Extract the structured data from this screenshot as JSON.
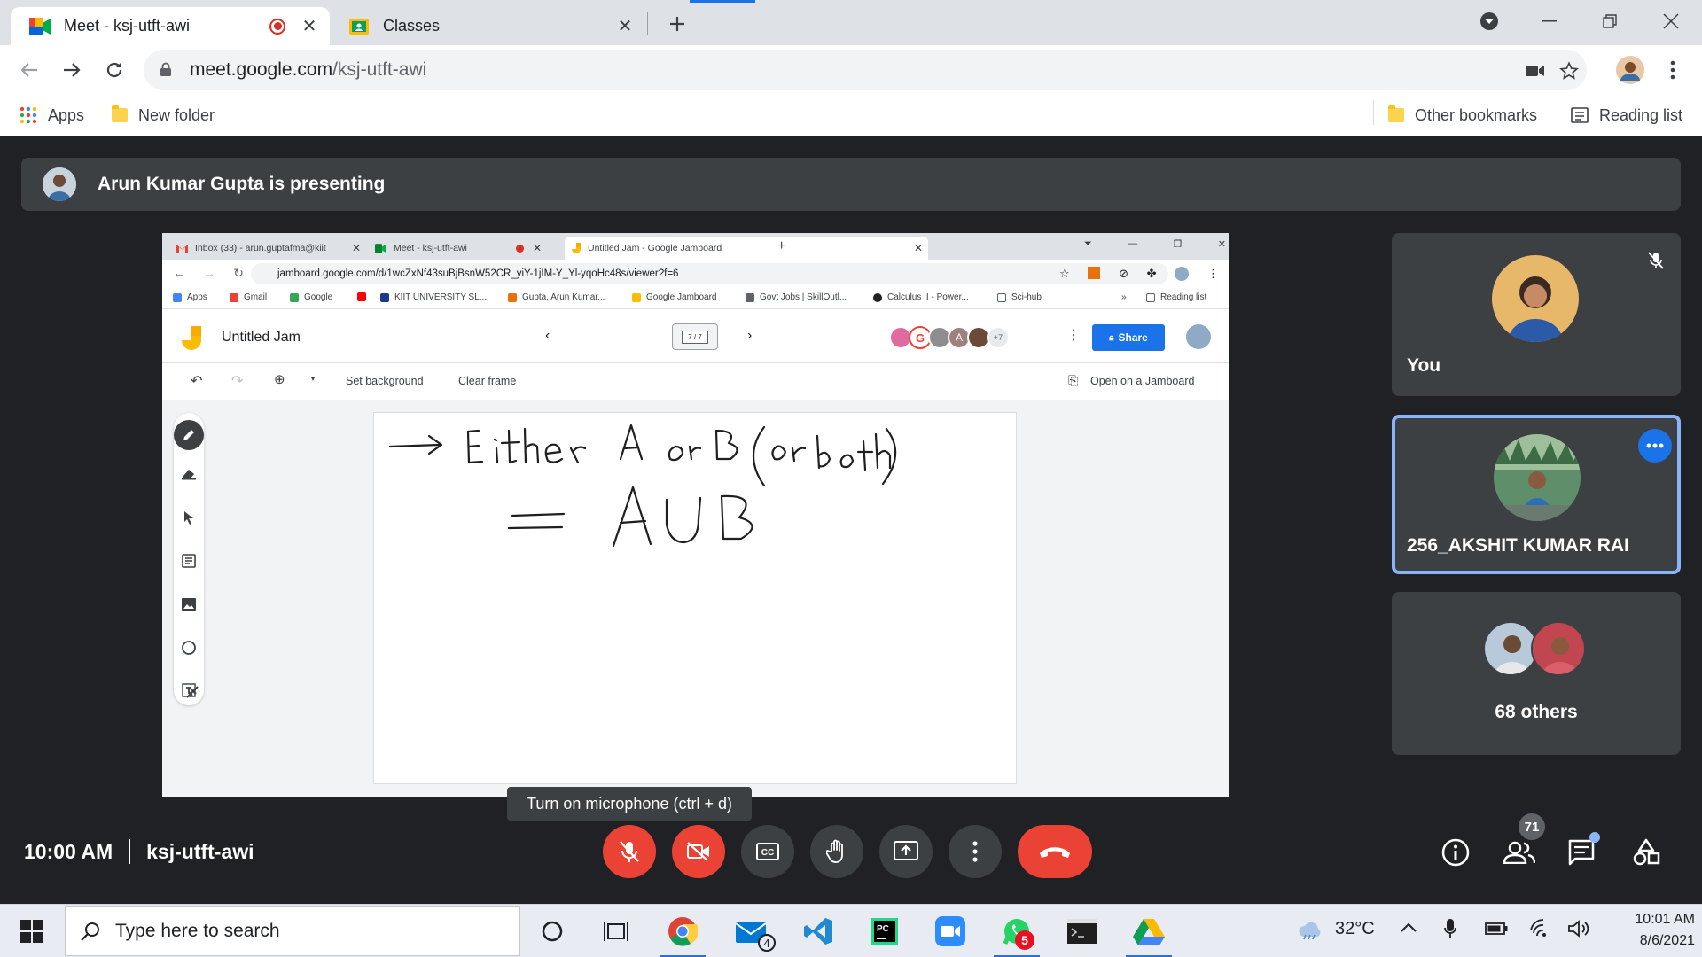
{
  "browser": {
    "tabs": [
      {
        "title": "Meet - ksj-utft-awi",
        "active": true,
        "recording": true
      },
      {
        "title": "Classes",
        "active": false
      }
    ],
    "url_host": "meet.google.com",
    "url_path": "/ksj-utft-awi",
    "bookmarks": {
      "apps": "Apps",
      "new_folder": "New folder",
      "other": "Other bookmarks",
      "reading_list": "Reading list"
    }
  },
  "meet": {
    "presenter_text": "Arun Kumar Gupta is presenting",
    "time": "10:00 AM",
    "meeting_code": "ksj-utft-awi",
    "tooltip": "Turn on microphone (ctrl + d)",
    "participants_count": "71",
    "tiles": [
      {
        "name": "You",
        "muted": true
      },
      {
        "name": "256_AKSHIT KUMAR RAI",
        "active_speaker": true
      },
      {
        "name": "68 others"
      }
    ],
    "accent_color": "#8ab4f8",
    "danger_color": "#ea4335"
  },
  "shared_screen": {
    "tabs": [
      "Inbox (33) - arun.guptafma@kiit",
      "Meet - ksj-utft-awi",
      "Untitled Jam - Google Jamboard"
    ],
    "url": "jamboard.google.com/d/1wcZxNf43suBjBsnW52CR_yiY-1jIM-Y_Yl-yqoHc48s/viewer?f=6",
    "bookmarks": [
      "Apps",
      "Gmail",
      "Google",
      "KIIT UNIVERSITY SL...",
      "Gupta, Arun Kumar...",
      "Google Jamboard",
      "Govt Jobs | SkillOutl...",
      "Calculus II - Power...",
      "Sci-hub"
    ],
    "bookmarks_more": "»",
    "reading_list": "Reading list",
    "jamboard": {
      "title": "Untitled Jam",
      "frame": "7 / 7",
      "collaborators_extra": "+7",
      "share_label": "Share",
      "set_background": "Set background",
      "clear_frame": "Clear frame",
      "open_on_jamboard": "Open on a Jamboard",
      "handwriting_line1": "→ Either A or B (or both)",
      "handwriting_line2": "= A∪B"
    }
  },
  "taskbar": {
    "search_placeholder": "Type here to search",
    "temperature": "32°C",
    "time": "10:01 AM",
    "date": "8/6/2021",
    "mail_badge": "4",
    "whatsapp_badge": "5"
  }
}
